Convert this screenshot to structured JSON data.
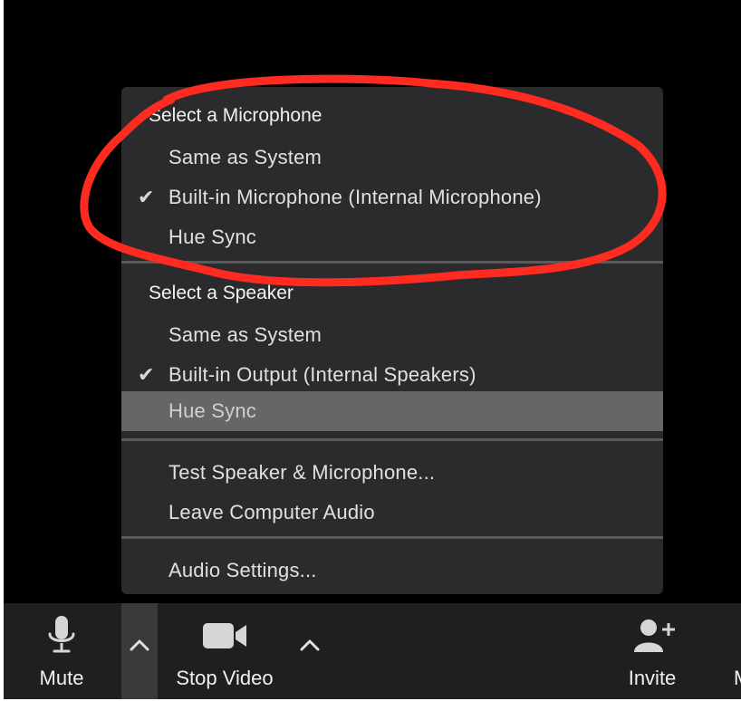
{
  "menu": {
    "microphone_header": "Select a Microphone",
    "microphone_options": [
      {
        "label": "Same as System",
        "checked": false
      },
      {
        "label": "Built-in Microphone (Internal Microphone)",
        "checked": true
      },
      {
        "label": "Hue Sync",
        "checked": false
      }
    ],
    "speaker_header": "Select a Speaker",
    "speaker_options": [
      {
        "label": "Same as System",
        "checked": false
      },
      {
        "label": "Built-in Output (Internal Speakers)",
        "checked": true
      },
      {
        "label": "Hue Sync",
        "checked": false,
        "highlighted": true
      }
    ],
    "test_label": "Test Speaker & Microphone...",
    "leave_label": "Leave Computer Audio",
    "settings_label": "Audio Settings..."
  },
  "toolbar": {
    "mute_label": "Mute",
    "video_label": "Stop Video",
    "invite_label": "Invite"
  },
  "colors": {
    "annotation": "#ff2a20",
    "menu_bg": "#2b2b2d",
    "highlight": "#666668",
    "toolbar_bg": "#1f1f1f"
  },
  "icons": {
    "check": "checkmark-icon",
    "mic": "microphone-icon",
    "video": "video-camera-icon",
    "chevron": "chevron-up-icon",
    "invite": "add-person-icon"
  }
}
